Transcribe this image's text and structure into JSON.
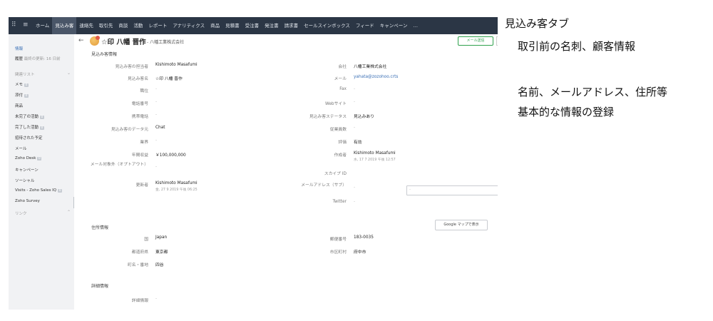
{
  "annotations": {
    "title": "見込み客タブ",
    "line1": "取引前の名刺、顧客情報",
    "line2": "名前、メールアドレス、住所等",
    "line3": "基本的な情報の登録"
  },
  "topnav": {
    "grid_icon": "apps-grid-icon",
    "menu_icon": "hamburger-icon",
    "tabs": [
      "ホーム",
      "見込み客",
      "連絡先",
      "取引先",
      "商談",
      "活動",
      "レポート",
      "アナリティクス",
      "商品",
      "見積書",
      "受注書",
      "発注書",
      "請求書",
      "セールスインボックス",
      "フィード",
      "キャンペーン",
      "…"
    ],
    "active_tab": "見込み客"
  },
  "sidebar": {
    "info": "情報",
    "history": "履歴",
    "history_sub": "最終の更新: 16 日前",
    "related_list": "関連リスト",
    "items": [
      {
        "label": "メモ",
        "count": "0"
      },
      {
        "label": "添付",
        "count": "0"
      },
      {
        "label": "商品",
        "count": ""
      },
      {
        "label": "未完了の活動",
        "count": "0"
      },
      {
        "label": "完了した活動",
        "count": "0"
      },
      {
        "label": "招待された予定",
        "count": ""
      },
      {
        "label": "メール",
        "count": ""
      },
      {
        "label": "Zoho Desk",
        "count": "0"
      },
      {
        "label": "キャンペーン",
        "count": ""
      },
      {
        "label": "ソーシャル",
        "count": ""
      },
      {
        "label": "Visits - Zoho Sales IQ",
        "count": "0"
      },
      {
        "label": "Zoho Survey",
        "count": ""
      }
    ],
    "links": "リンク"
  },
  "header": {
    "back_icon": "arrow-left-icon",
    "name": "☆印 八幡 晋作",
    "company": "- 八幡工業株式会社",
    "mail_button": "メール送信"
  },
  "lead_info": {
    "section": "見込み客情報",
    "left": [
      {
        "label": "見込み客の担当者",
        "value": "Kishimoto Masafumi"
      },
      {
        "label": "見込み客名",
        "value": "☆印 八幡 晋作"
      },
      {
        "label": "職位",
        "value": "-"
      },
      {
        "label": "電話番号",
        "value": "-"
      },
      {
        "label": "携帯電話",
        "value": "-"
      },
      {
        "label": "見込み客のデータ元",
        "value": "Chat"
      },
      {
        "label": "業界",
        "value": "-"
      },
      {
        "label": "年間収益",
        "value": "￥100,000,000"
      },
      {
        "label": "メール対象外（オプトアウト）",
        "value": "-"
      },
      {
        "label": "更新者",
        "value": "Kishimoto Masafumi",
        "sub": "金, 27 9 2019 午後 06:25"
      }
    ],
    "right": [
      {
        "label": "会社",
        "value": "八幡工業株式会社"
      },
      {
        "label": "メール",
        "value": "yahata@zozohoo.crts"
      },
      {
        "label": "Fax",
        "value": "-"
      },
      {
        "label": "Webサイト",
        "value": "-"
      },
      {
        "label": "見込み客ステータス",
        "value": "見込みあり"
      },
      {
        "label": "従業員数",
        "value": "-"
      },
      {
        "label": "評価",
        "value": "有効"
      },
      {
        "label": "作成者",
        "value": "Kishimoto Masafumi",
        "sub": "水, 17 7 2019 午後 12:57"
      },
      {
        "label": "スカイプ ID",
        "value": "-"
      },
      {
        "label": "メールアドレス（サブ）",
        "value": "-"
      },
      {
        "label": "Twitter",
        "value": "-"
      }
    ],
    "skype_edit_icon": "pencil-icon"
  },
  "address": {
    "section": "住所情報",
    "google_map_button": "Google マップで表示",
    "left": [
      {
        "label": "国",
        "value": "Japan"
      },
      {
        "label": "都道府県",
        "value": "東京都"
      },
      {
        "label": "町名・番地",
        "value": "四谷"
      }
    ],
    "right": [
      {
        "label": "郵便番号",
        "value": "183-0035"
      },
      {
        "label": "市区町村",
        "value": "府中市"
      }
    ]
  },
  "details": {
    "section": "詳細情報",
    "label": "詳細情報",
    "value": "-"
  }
}
